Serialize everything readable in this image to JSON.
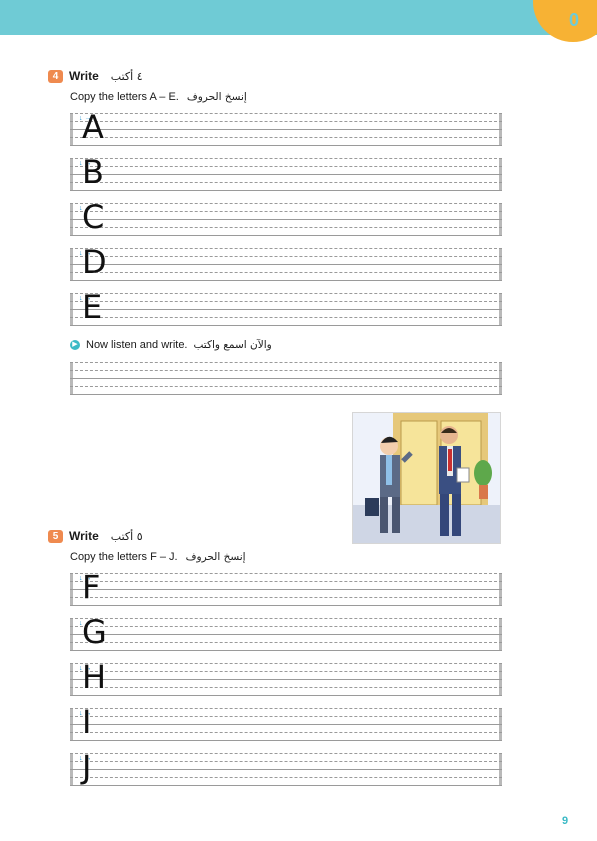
{
  "header": {
    "unit_number": "0"
  },
  "exercise4": {
    "number": "4",
    "title": "Write",
    "title_ar": "٤ أكتب",
    "instruction": "Copy the letters A – E.",
    "instruction_ar": "إنسخ الحروف",
    "letters": [
      "A",
      "B",
      "C",
      "D",
      "E"
    ]
  },
  "listen": {
    "text": "Now listen and write.",
    "text_ar": "والآن اسمع واكتب"
  },
  "exercise5": {
    "number": "5",
    "title": "Write",
    "title_ar": "٥ أكتب",
    "instruction": "Copy the letters F – J.",
    "instruction_ar": "إنسخ الحروف",
    "letters": [
      "F",
      "G",
      "H",
      "I",
      "J"
    ]
  },
  "page_number": "9",
  "colors": {
    "header": "#6fcbd5",
    "accent": "#f7b234",
    "badge": "#ef8a4f",
    "guide": "#1a8fd0"
  },
  "icons": {
    "illustration": "two-businessmen-illustration",
    "audio": "audio-icon"
  }
}
